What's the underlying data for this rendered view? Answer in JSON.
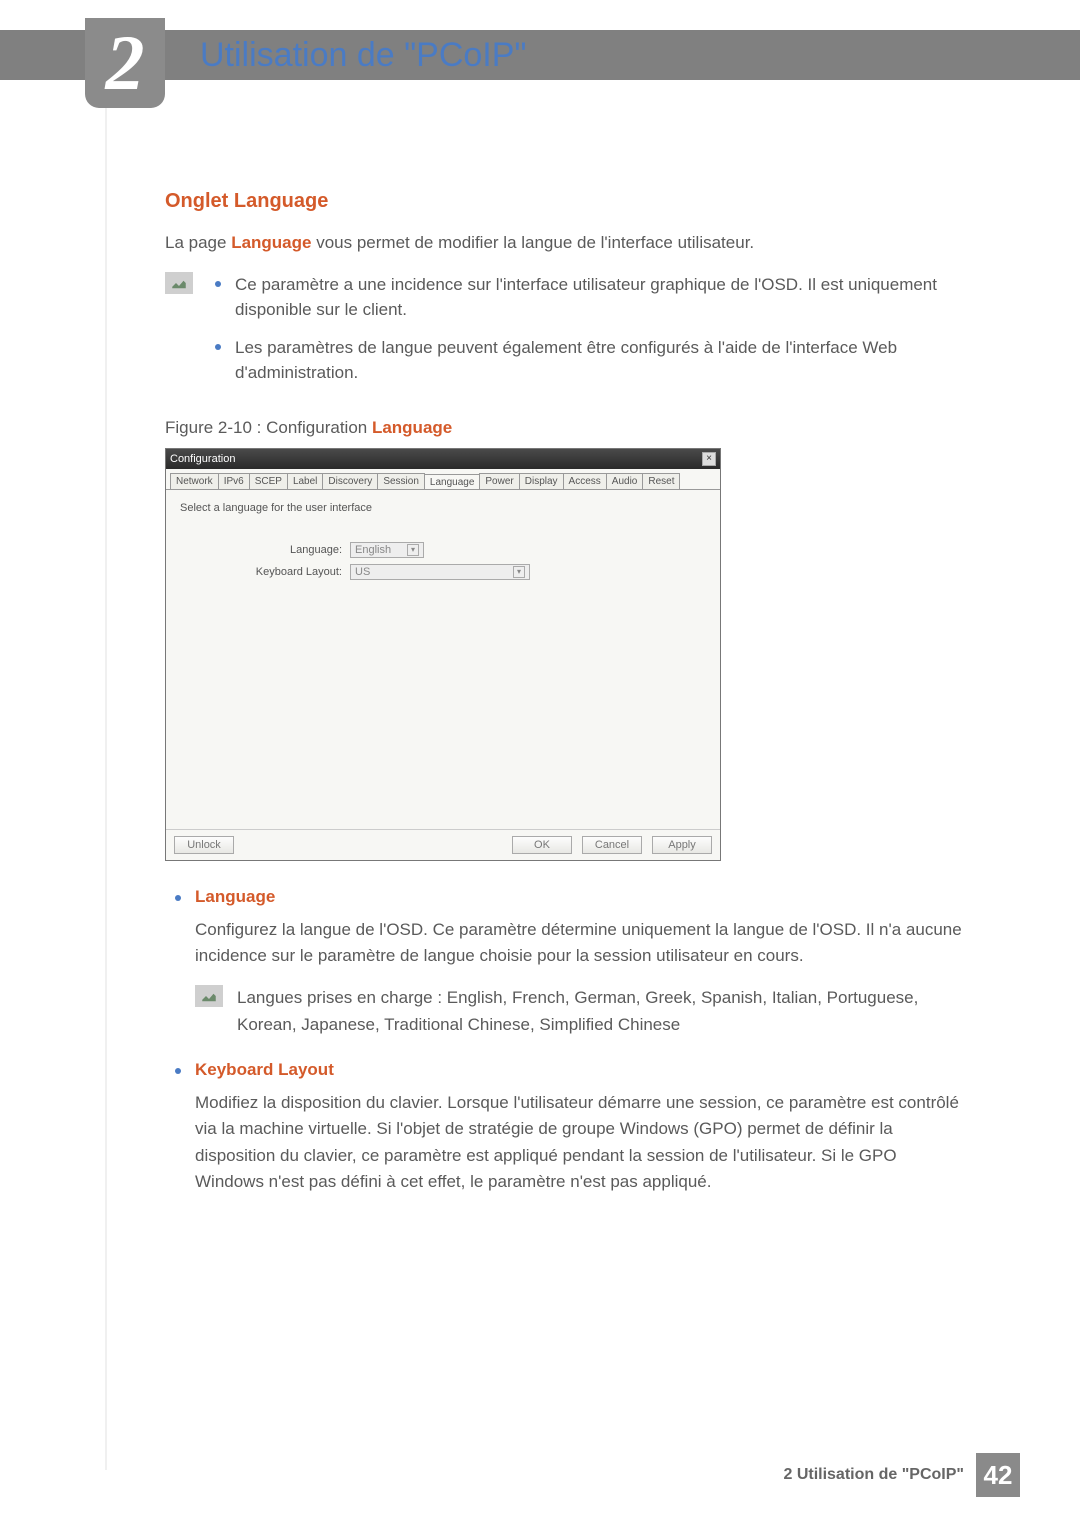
{
  "chapter": {
    "number": "2",
    "title": "Utilisation de \"PCoIP\""
  },
  "section": {
    "heading": "Onglet Language",
    "intro_pre": "La page ",
    "intro_hl": "Language",
    "intro_post": " vous permet de modifier la langue de l'interface utilisateur.",
    "notes": [
      "Ce paramètre a une incidence sur l'interface utilisateur graphique de l'OSD. Il est uniquement disponible sur le client.",
      "Les paramètres de langue peuvent également être configurés à l'aide de l'interface Web d'administration."
    ],
    "figure_pre": "Figure 2-10 : Configuration ",
    "figure_hl": "Language"
  },
  "dialog": {
    "title": "Configuration",
    "tabs": [
      "Network",
      "IPv6",
      "SCEP",
      "Label",
      "Discovery",
      "Session",
      "Language",
      "Power",
      "Display",
      "Access",
      "Audio",
      "Reset"
    ],
    "active_tab": "Language",
    "desc": "Select a language for the user interface",
    "language_label": "Language:",
    "language_value": "English",
    "keyboard_label": "Keyboard Layout:",
    "keyboard_value": "US",
    "buttons": {
      "unlock": "Unlock",
      "ok": "OK",
      "cancel": "Cancel",
      "apply": "Apply"
    }
  },
  "defs": {
    "language": {
      "title": "Language",
      "body": "Configurez la langue de l'OSD. Ce paramètre détermine uniquement la langue de l'OSD. Il n'a aucune incidence sur le paramètre de langue choisie pour la session utilisateur en cours.",
      "note": "Langues prises en charge : English, French, German, Greek, Spanish, Italian, Portuguese, Korean, Japanese, Traditional Chinese, Simplified Chinese"
    },
    "keyboard": {
      "title": "Keyboard Layout",
      "body": "Modifiez la disposition du clavier. Lorsque l'utilisateur démarre une session, ce paramètre est contrôlé via la machine virtuelle. Si l'objet de stratégie de groupe Windows (GPO) permet de définir la disposition du clavier, ce paramètre est appliqué pendant la session de l'utilisateur. Si le GPO Windows n'est pas défini à cet effet, le paramètre n'est pas appliqué."
    }
  },
  "footer": {
    "text": "2 Utilisation de \"PCoIP\"",
    "page": "42"
  }
}
